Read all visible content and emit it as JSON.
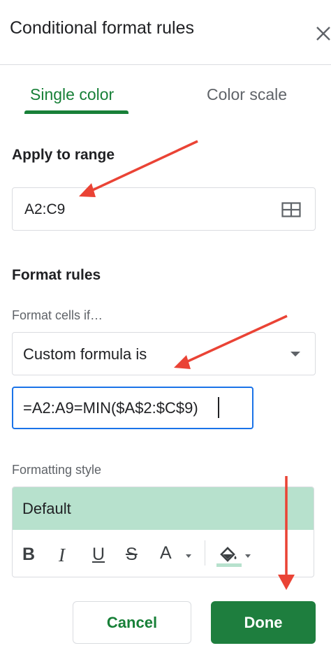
{
  "panel": {
    "title": "Conditional format rules",
    "close_icon": "close-icon"
  },
  "tabs": [
    {
      "label": "Single color",
      "active": true
    },
    {
      "label": "Color scale",
      "active": false
    }
  ],
  "apply_range": {
    "heading": "Apply to range",
    "value": "A2:C9",
    "icon": "grid-select-icon"
  },
  "format_rules": {
    "heading": "Format rules",
    "condition_label": "Format cells if…",
    "condition_value": "Custom formula is",
    "formula_value": "=A2:A9=MIN($A$2:$C$9)"
  },
  "formatting_style": {
    "label": "Formatting style",
    "preview_label": "Default",
    "preview_color": "#b7e1cd",
    "tools": [
      "bold-icon",
      "italic-icon",
      "underline-icon",
      "strikethrough-icon",
      "text-color-icon",
      "fill-color-icon"
    ]
  },
  "actions": {
    "cancel_label": "Cancel",
    "done_label": "Done"
  },
  "colors": {
    "accent_green": "#188038",
    "done_bg": "#1e7e3e",
    "focus_blue": "#1a73e8",
    "annotation_red": "#ea4335"
  }
}
